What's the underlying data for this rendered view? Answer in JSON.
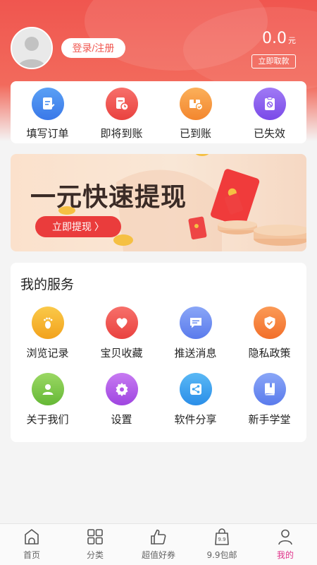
{
  "header": {
    "login_label": "登录/注册",
    "balance_value": "0.0",
    "balance_unit": "元",
    "withdraw_label": "立即取款"
  },
  "orders": [
    {
      "label": "填写订单",
      "icon": "edit-order-icon",
      "color": "#4a8ef0"
    },
    {
      "label": "即将到账",
      "icon": "clock-doc-icon",
      "color": "#f0564f"
    },
    {
      "label": "已到账",
      "icon": "package-check-icon",
      "color": "#f59b3d"
    },
    {
      "label": "已失效",
      "icon": "invalid-clipboard-icon",
      "color": "#8a5cf0"
    }
  ],
  "banner": {
    "title": "一元快速提现",
    "button_label": "立即提现 〉"
  },
  "services": {
    "title": "我的服务",
    "items": [
      {
        "label": "浏览记录",
        "icon": "footprint-icon",
        "color": "#f5b731"
      },
      {
        "label": "宝贝收藏",
        "icon": "heart-icon",
        "color": "#f0564f"
      },
      {
        "label": "推送消息",
        "icon": "message-icon",
        "color": "#6b8df2"
      },
      {
        "label": "隐私政策",
        "icon": "shield-icon",
        "color": "#f6843a"
      },
      {
        "label": "关于我们",
        "icon": "user-icon",
        "color": "#7cc84a"
      },
      {
        "label": "设置",
        "icon": "gear-icon",
        "color": "#b357e8"
      },
      {
        "label": "软件分享",
        "icon": "share-icon",
        "color": "#3aa3f0"
      },
      {
        "label": "新手学堂",
        "icon": "book-icon",
        "color": "#6b8df2"
      }
    ]
  },
  "tabbar": [
    {
      "label": "首页",
      "icon": "home-icon",
      "active": false
    },
    {
      "label": "分类",
      "icon": "category-grid-icon",
      "active": false
    },
    {
      "label": "超值好券",
      "icon": "thumbs-up-icon",
      "active": false
    },
    {
      "label": "9.9包邮",
      "icon": "shopping-bag-icon",
      "active": false
    },
    {
      "label": "我的",
      "icon": "profile-icon",
      "active": true
    }
  ]
}
